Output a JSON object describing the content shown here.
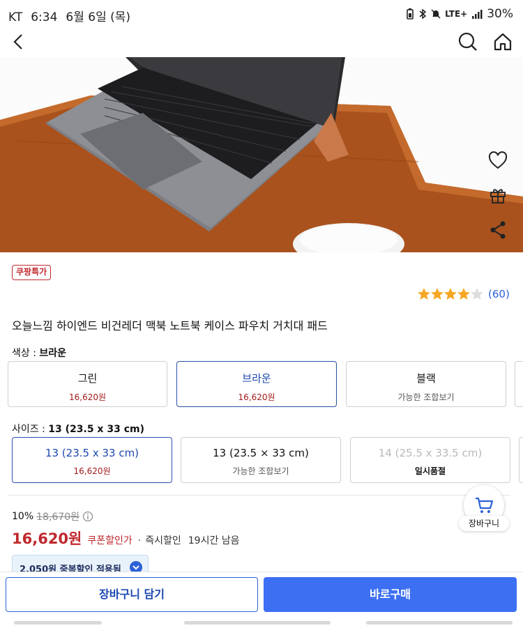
{
  "status_bar": {
    "carrier": "KT",
    "time": "6:34",
    "date": "6월 6일 (목)",
    "network": "LTE+",
    "battery": "30%"
  },
  "app_bar": {
    "back_icon": "back-arrow-icon",
    "search_icon": "search-icon",
    "home_icon": "home-icon"
  },
  "side_actions": {
    "wishlist_icon": "heart-icon",
    "gift_icon": "gift-icon",
    "share_icon": "share-icon"
  },
  "badge": "쿠팡특가",
  "rating": {
    "stars": 4.5,
    "count": "(60)"
  },
  "product_title": "오늘느낌 하이엔드 비건레더 맥북 노트북 케이스 파우치 거치대 패드",
  "color_option": {
    "label": "색상 : ",
    "selected": "브라운",
    "items": [
      {
        "name": "그린",
        "sub": "16,620원"
      },
      {
        "name": "브라운",
        "sub": "16,620원"
      },
      {
        "name": "블랙",
        "sub": "가능한 조합보기"
      }
    ]
  },
  "size_option": {
    "label": "사이즈 : ",
    "selected": "13 (23.5 x 33 cm)",
    "items": [
      {
        "name": "13 (23.5 x 33 cm)",
        "sub": "16,620원"
      },
      {
        "name": "13 (23.5 × 33 cm)",
        "sub": "가능한 조합보기"
      },
      {
        "name": "14 (25.5 x 33.5 cm)",
        "sub": "일시품절"
      }
    ]
  },
  "price": {
    "discount": "10%",
    "original": "18,670원",
    "final": "16,620원",
    "coupon": "쿠폰할인가",
    "sep": "·",
    "instant": "즉시할인",
    "time_left": "19시간 남음",
    "dup_discount": "2,050원 중복할인 적용됨"
  },
  "floating_cart": {
    "label": "장바구니"
  },
  "bottom": {
    "add_to_cart": "장바구니 담기",
    "buy_now": "바로구매"
  },
  "colors": {
    "accent_blue": "#3d6ff3",
    "price_red": "#c0282d",
    "star": "#f5a623"
  }
}
